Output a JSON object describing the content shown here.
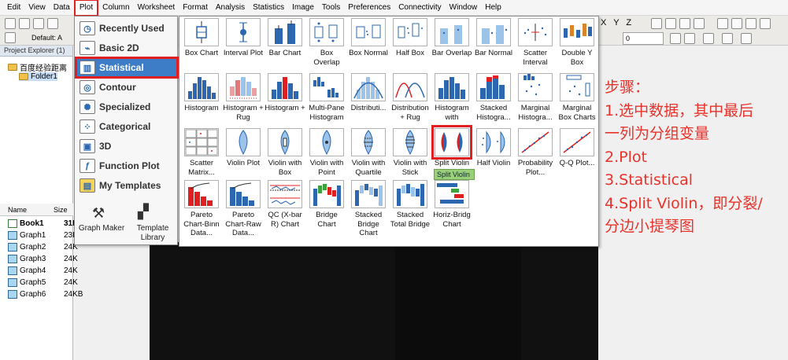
{
  "menubar": {
    "items": [
      "Edit",
      "View",
      "Data",
      "Plot",
      "Column",
      "Worksheet",
      "Format",
      "Analysis",
      "Statistics",
      "Image",
      "Tools",
      "Preferences",
      "Connectivity",
      "Window",
      "Help"
    ],
    "active": "Plot"
  },
  "toolbar": {
    "default_font_label": "Default: A",
    "combo_value": "0"
  },
  "project_explorer": {
    "title": "Project Explorer (1)",
    "root": "百度经验距离",
    "folder": "Folder1"
  },
  "file_list": {
    "col_name": "Name",
    "col_size": "Size",
    "rows": [
      {
        "name": "Book1",
        "size": "31K",
        "type": "book"
      },
      {
        "name": "Graph1",
        "size": "23K",
        "type": "graph"
      },
      {
        "name": "Graph2",
        "size": "24K",
        "type": "graph"
      },
      {
        "name": "Graph3",
        "size": "24K",
        "type": "graph"
      },
      {
        "name": "Graph4",
        "size": "24K",
        "type": "graph"
      },
      {
        "name": "Graph5",
        "size": "24K",
        "type": "graph"
      },
      {
        "name": "Graph6",
        "size": "24KB",
        "type": "graph"
      }
    ]
  },
  "plot_menu": {
    "items": [
      {
        "label": "Recently Used",
        "icon": "clock-icon"
      },
      {
        "label": "Basic 2D",
        "icon": "line-chart-icon"
      },
      {
        "label": "Statistical",
        "icon": "histogram-icon",
        "active": true
      },
      {
        "label": "Contour",
        "icon": "contour-icon"
      },
      {
        "label": "Specialized",
        "icon": "polar-icon"
      },
      {
        "label": "Categorical",
        "icon": "categorical-icon"
      },
      {
        "label": "3D",
        "icon": "cube-icon"
      },
      {
        "label": "Function Plot",
        "icon": "function-icon"
      },
      {
        "label": "My Templates",
        "icon": "templates-icon"
      }
    ],
    "graph_maker": "Graph Maker",
    "template_library_1": "Template",
    "template_library_2": "Library"
  },
  "gallery": {
    "rows": [
      [
        "Box Chart",
        "Interval Plot",
        "Bar Chart",
        "Box Overlap",
        "Box Normal",
        "Half Box",
        "Bar Overlap",
        "Bar Normal",
        "Scatter Interval",
        "Double Y Box"
      ],
      [
        "Histogram",
        "Histogram + Rug",
        "Histogram +",
        "Multi-Pane Histogram",
        "Distributi...",
        "Distribution + Rug",
        "Histogram with",
        "Stacked Histogra...",
        "Marginal Histogra...",
        "Marginal Box Charts"
      ],
      [
        "Scatter Matrix...",
        "Violin Plot",
        "Violin with Box",
        "Violin with Point",
        "Violin with Quartile",
        "Violin with Stick",
        "Split Violin",
        "Half Violin",
        "Probability Plot...",
        "Q-Q Plot..."
      ],
      [
        "Pareto Chart-Binn Data...",
        "Pareto Chart-Raw Data...",
        "QC (X-bar R) Chart",
        "Bridge Chart",
        "Stacked Bridge Chart",
        "Stacked Total Bridge",
        "Horiz-Bridg Chart"
      ]
    ],
    "highlighted": "Split Violin",
    "tooltip": "Split Violin"
  },
  "annotation": {
    "lines": [
      "步骤：",
      "1.选中数据，其中最后",
      "一列为分组变量",
      "2.Plot",
      "3.Statistical",
      "4.Split Violin，即分裂/",
      "分边小提琴图"
    ]
  },
  "colors": {
    "highlight_red": "#e02020",
    "menu_active": "#3d7dc8",
    "annotation_red": "#e8322a",
    "tooltip_green": "#9ad07a"
  }
}
